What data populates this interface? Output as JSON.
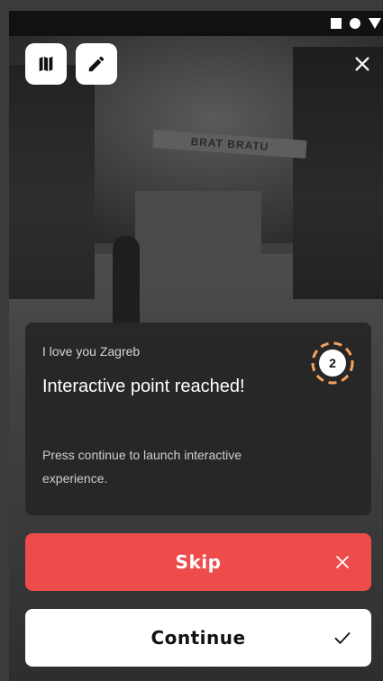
{
  "status_bar": {
    "icons": [
      "square-icon",
      "circle-icon",
      "triangle-icon"
    ]
  },
  "toolbar": {
    "map_icon": "map-icon",
    "edit_icon": "pencil-icon",
    "close_icon": "close-icon"
  },
  "background": {
    "banner_text": "BRAT BRATU"
  },
  "card": {
    "subtitle": "I love you Zagreb",
    "title": "Interactive point reached!",
    "description": "Press continue to launch interactive experience.",
    "badge_number": "2",
    "badge_color": "#f5a25d"
  },
  "buttons": {
    "skip_label": "Skip",
    "skip_color": "#ee4b4b",
    "continue_label": "Continue",
    "continue_color": "#ffffff"
  }
}
